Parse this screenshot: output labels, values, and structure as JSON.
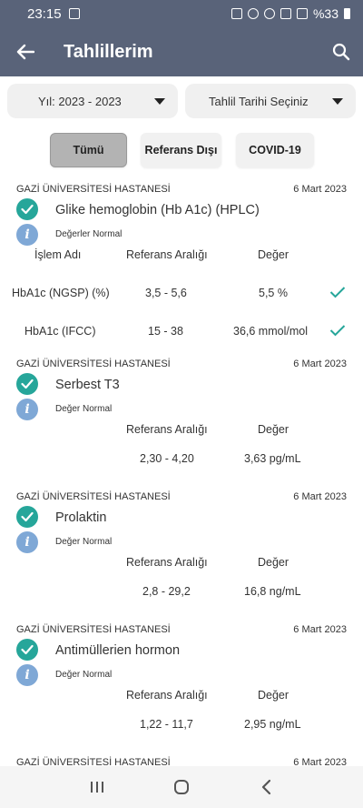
{
  "status_bar": {
    "time": "23:15",
    "battery": "%33"
  },
  "app_bar": {
    "title": "Tahlillerim"
  },
  "filters": {
    "year": "Yıl: 2023 - 2023",
    "date": "Tahlil Tarihi Seçiniz"
  },
  "tabs": [
    {
      "label": "Tümü",
      "active": true
    },
    {
      "label": "Referans Dışı",
      "active": false
    },
    {
      "label": "COVID-19",
      "active": false
    }
  ],
  "records": [
    {
      "hospital": "GAZİ ÜNİVERSİTESİ HASTANESİ",
      "date": "6 Mart 2023",
      "test": "Glike hemoglobin (Hb A1c) (HPLC)",
      "status": "Değerler Normal",
      "headers": {
        "name": "İşlem Adı",
        "range": "Referans Aralığı",
        "value": "Değer"
      },
      "rows": [
        {
          "name": "HbA1c (NGSP) (%)",
          "range": "3,5 - 5,6",
          "value": "5,5 %"
        },
        {
          "name": "HbA1c (IFCC)",
          "range": "15 - 38",
          "value": "36,6 mmol/mol"
        }
      ]
    },
    {
      "hospital": "GAZİ ÜNİVERSİTESİ HASTANESİ",
      "date": "6 Mart 2023",
      "test": "Serbest T3",
      "status": "Değer Normal",
      "headers": {
        "range": "Referans Aralığı",
        "value": "Değer"
      },
      "rows": [
        {
          "range": "2,30 - 4,20",
          "value": "3,63 pg/mL"
        }
      ]
    },
    {
      "hospital": "GAZİ ÜNİVERSİTESİ HASTANESİ",
      "date": "6 Mart 2023",
      "test": "Prolaktin",
      "status": "Değer Normal",
      "headers": {
        "range": "Referans Aralığı",
        "value": "Değer"
      },
      "rows": [
        {
          "range": "2,8 - 29,2",
          "value": "16,8 ng/mL"
        }
      ]
    },
    {
      "hospital": "GAZİ ÜNİVERSİTESİ HASTANESİ",
      "date": "6 Mart 2023",
      "test": "Antimüllerien hormon",
      "status": "Değer Normal",
      "headers": {
        "range": "Referans Aralığı",
        "value": "Değer"
      },
      "rows": [
        {
          "range": "1,22 - 11,7",
          "value": "2,95 ng/mL"
        }
      ]
    },
    {
      "hospital": "GAZİ ÜNİVERSİTESİ HASTANESİ",
      "date": "6 Mart 2023"
    }
  ],
  "colors": {
    "header": "#596379",
    "check": "#26a69a",
    "info": "#7fa8d6"
  },
  "icons": [
    "back-arrow-icon",
    "search-icon",
    "check-circle-icon",
    "info-icon",
    "checkmark-icon",
    "recents-icon",
    "home-icon",
    "back-nav-icon"
  ]
}
